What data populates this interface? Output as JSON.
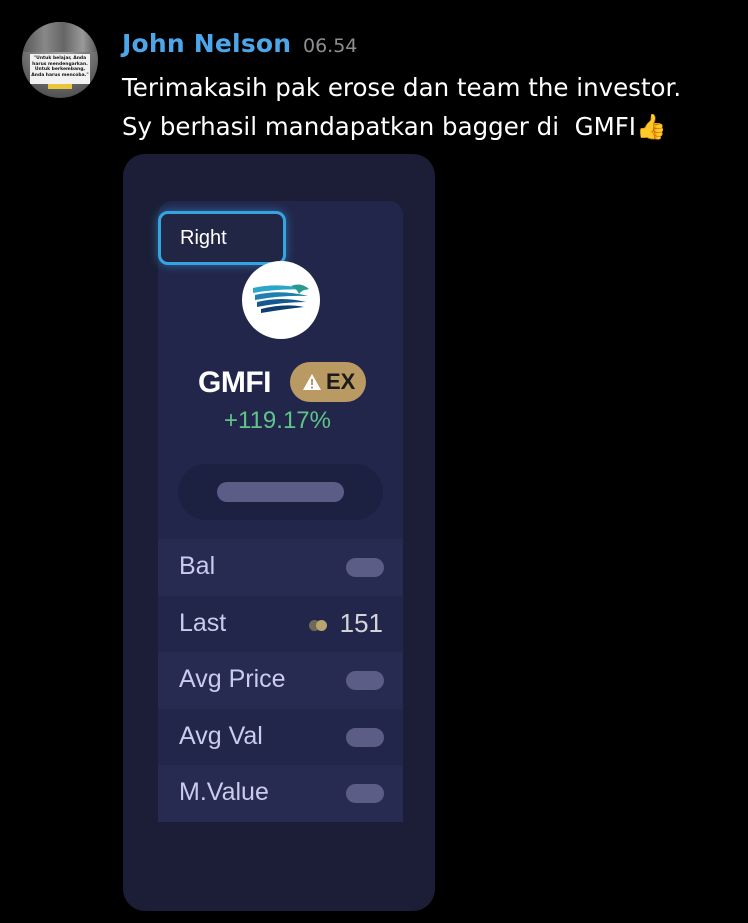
{
  "message": {
    "sender": "John Nelson",
    "time": "06.54",
    "line1": "Terimakasih pak erose dan team the investor.",
    "line2": "Sy berhasil mandapatkan bagger di  GMFI👍",
    "avatar_quote": "\"Untuk belajar, Anda harus mendengarkan. Untuk berkembang, Anda harus mencoba.\""
  },
  "attachment": {
    "right_label": "Right",
    "ticker": "GMFI",
    "badge_label": "EX",
    "change": "+119.17%",
    "rows": [
      {
        "label": "Bal",
        "value": null
      },
      {
        "label": "Last",
        "value": "151"
      },
      {
        "label": "Avg Price",
        "value": null
      },
      {
        "label": "Avg Val",
        "value": null
      },
      {
        "label": "M.Value",
        "value": null
      }
    ]
  },
  "colors": {
    "username": "#4ea6ea",
    "positive": "#5ec489",
    "badge": "#b99a63",
    "highlight_border": "#37a4e2"
  }
}
